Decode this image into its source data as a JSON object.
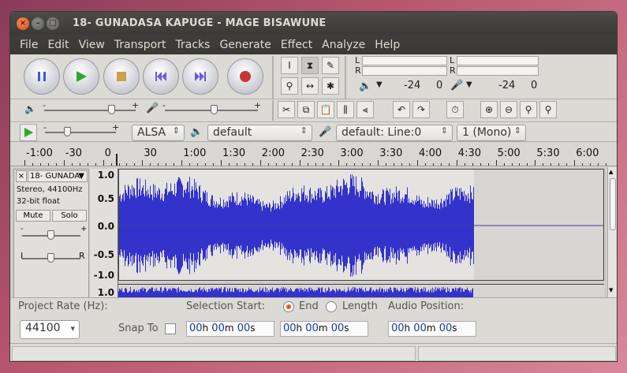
{
  "window": {
    "title": "18- GUNADASA  KAPUGE - MAGE  BISAWUNE"
  },
  "menu": [
    "File",
    "Edit",
    "View",
    "Transport",
    "Tracks",
    "Generate",
    "Effect",
    "Analyze",
    "Help"
  ],
  "meters": {
    "left": "L",
    "right": "R",
    "play_db": "-24",
    "play_zero": "0",
    "rec_db": "-24",
    "rec_zero": "0"
  },
  "mixer": {
    "minus": "-",
    "plus": "+"
  },
  "device": {
    "host": "ALSA",
    "output": "default",
    "input": "default: Line:0",
    "channels": "1 (Mono)"
  },
  "ruler": {
    "ticks": [
      "-1:00",
      "-30",
      "0",
      "30",
      "1:00",
      "1:30",
      "2:00",
      "2:30",
      "3:00",
      "3:30",
      "4:00",
      "4:30",
      "5:00",
      "5:30",
      "6:00"
    ]
  },
  "track": {
    "name": "18- GUNADA",
    "info1": "Stereo, 44100Hz",
    "info2": "32-bit float",
    "mute": "Mute",
    "solo": "Solo",
    "gain_minus": "-",
    "gain_plus": "+",
    "pan_left": "L",
    "pan_right": "R",
    "scale": [
      "1.0",
      "0.5",
      "0.0",
      "-0.5",
      "-1.0"
    ],
    "scale2": "1.0",
    "audio_end_fraction": 0.73
  },
  "selection": {
    "project_rate_label": "Project Rate (Hz):",
    "project_rate": "44100",
    "snap_to": "Snap To",
    "selection_start": "Selection Start:",
    "end": "End",
    "length": "Length",
    "audio_position": "Audio Position:",
    "time": {
      "h": "00",
      "m": "00",
      "s": "00",
      "hu": "h",
      "mu": "m",
      "su": "s"
    }
  },
  "colors": {
    "wave": "#3333cc",
    "wave_bg": "#d7d5d2"
  }
}
